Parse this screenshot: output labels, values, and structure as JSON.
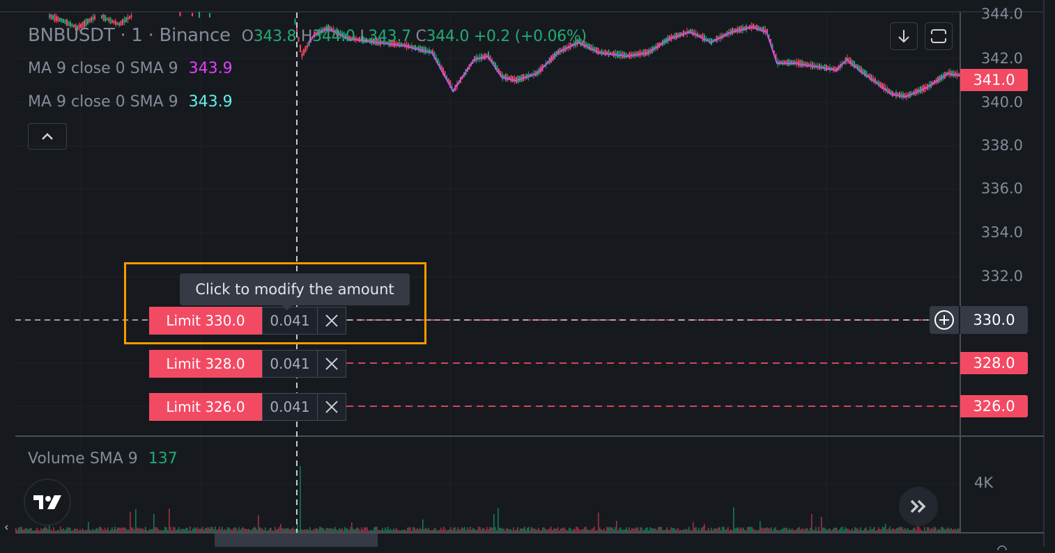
{
  "symbol": {
    "ticker": "BNBUSDT",
    "interval": "1",
    "exchange": "Binance",
    "separator": "·",
    "ohlc": {
      "open_label": "O",
      "open": "343.8",
      "high_label": "H",
      "high": "344.0",
      "low_label": "L",
      "low": "343.7",
      "close_label": "C",
      "close": "344.0",
      "change": "+0.2",
      "change_pct": "(+0.06%)"
    }
  },
  "indicators": [
    {
      "label": "MA 9 close 0 SMA 9",
      "value": "343.9",
      "color": "#e040fb"
    },
    {
      "label": "MA 9 close 0 SMA 9",
      "value": "343.9",
      "color": "#5cf4ee"
    }
  ],
  "volume": {
    "label": "Volume SMA 9",
    "value": "137",
    "color": "#22ab76",
    "axis_label": "4K"
  },
  "price_axis": {
    "labels": [
      "344.0",
      "342.0",
      "340.0",
      "338.0",
      "336.0",
      "334.0",
      "332.0"
    ],
    "current_price": "341.0",
    "crosshair_price": "330.0"
  },
  "orders": [
    {
      "label": "Limit 330.0",
      "price": 330.0,
      "qty": "0.041",
      "axis_tag": "330.0"
    },
    {
      "label": "Limit 328.0",
      "price": 328.0,
      "qty": "0.041",
      "axis_tag": "328.0"
    },
    {
      "label": "Limit 326.0",
      "price": 326.0,
      "qty": "0.041",
      "axis_tag": "326.0"
    }
  ],
  "tooltip": "Click to modify the amount",
  "buttons": {
    "collapse": "collapse-legend",
    "scroll_down": "scroll-to-bottom",
    "fullscreen": "fullscreen",
    "scroll_realtime": "scroll-to-realtime"
  },
  "colors": {
    "up": "#22ab76",
    "down": "#f34a63",
    "background": "#161a1f",
    "highlight": "#ff9a00"
  }
}
